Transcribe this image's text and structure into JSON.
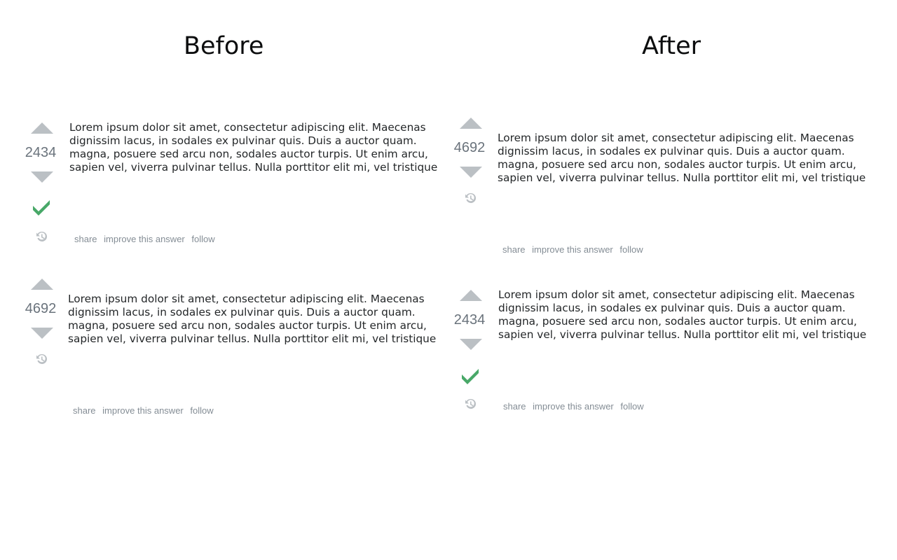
{
  "headings": {
    "before": "Before",
    "after": "After"
  },
  "post_lines": [
    "Lorem ipsum dolor sit amet, consectetur adipiscing elit. Maecenas",
    "dignissim lacus, in sodales ex pulvinar quis. Duis a auctor quam.",
    "magna, posuere sed arcu non, sodales auctor turpis. Ut enim arcu,",
    "sapien vel, viverra pulvinar tellus. Nulla porttitor elit mi, vel tristique"
  ],
  "menu": {
    "share": "share",
    "improve": "improve this answer",
    "follow": "follow"
  },
  "before": {
    "answer1": {
      "votes": "2434",
      "accepted": true
    },
    "answer2": {
      "votes": "4692",
      "accepted": false
    }
  },
  "after": {
    "answer1": {
      "votes": "4692",
      "accepted": false
    },
    "answer2": {
      "votes": "2434",
      "accepted": true
    }
  },
  "colors": {
    "vote_arrow": "#bbc0c4",
    "vote_count": "#6a737c",
    "accepted_check": "#48a868",
    "history_icon": "#bbc0c4",
    "menu_link": "#848d95",
    "body_text": "#242729"
  },
  "icons": {
    "vote_up": "triangle-up",
    "vote_down": "triangle-down",
    "accepted": "checkmark",
    "history": "clock-history"
  }
}
